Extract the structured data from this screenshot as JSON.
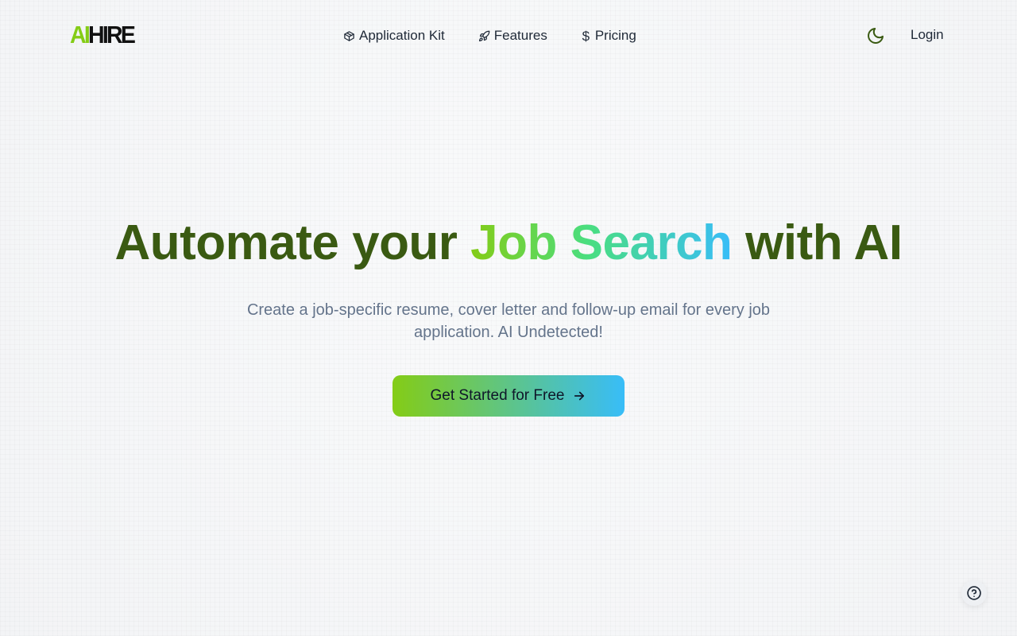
{
  "brand": {
    "logo_part1": "AI",
    "logo_part2": "HIRE",
    "accent_color": "#84cc16"
  },
  "nav": {
    "items": [
      {
        "label": "Application Kit",
        "icon": "box-icon"
      },
      {
        "label": "Features",
        "icon": "rocket-icon"
      },
      {
        "label": "Pricing",
        "icon": "dollar-icon"
      }
    ],
    "theme_toggle_icon": "moon-icon",
    "login_label": "Login"
  },
  "hero": {
    "title_prefix": "Automate your ",
    "title_highlight": "Job Search",
    "title_suffix": " with AI",
    "subtitle": "Create a job-specific resume, cover letter and follow-up email for every job application. AI Undetected!",
    "cta_label": "Get Started for Free",
    "cta_icon": "arrow-right-icon",
    "title_color": "#3a5a12",
    "gradient_start": "#84cc16",
    "gradient_end": "#38bdf8"
  },
  "help": {
    "icon": "help-circle-icon"
  }
}
